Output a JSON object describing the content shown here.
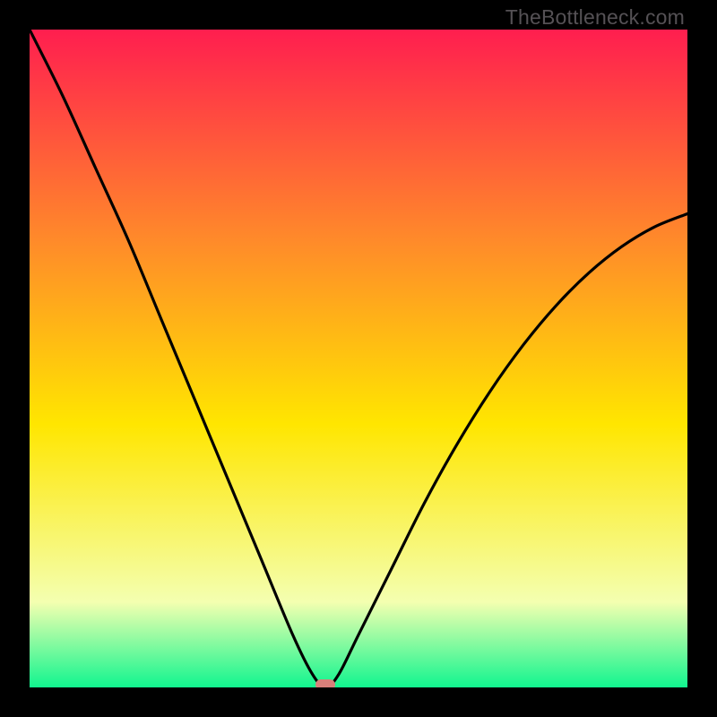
{
  "watermark": "TheBottleneck.com",
  "chart_data": {
    "type": "line",
    "title": "",
    "xlabel": "",
    "ylabel": "",
    "xlim": [
      0,
      100
    ],
    "ylim": [
      0,
      100
    ],
    "series": [
      {
        "name": "bottleneck-curve",
        "x": [
          0,
          5,
          10,
          15,
          20,
          25,
          30,
          35,
          40,
          43,
          45,
          47,
          50,
          55,
          60,
          65,
          70,
          75,
          80,
          85,
          90,
          95,
          100
        ],
        "y": [
          100,
          90,
          79,
          68,
          56,
          44,
          32,
          20,
          8,
          2,
          0,
          2,
          8,
          18,
          28,
          37,
          45,
          52,
          58,
          63,
          67,
          70,
          72
        ]
      }
    ],
    "minimum_point": {
      "x": 45,
      "y": 0
    },
    "gradient_colors": {
      "top": "#ff1e4f",
      "q1": "#ff8a2a",
      "mid": "#ffe600",
      "q3": "#f4ffb0",
      "bottom": "#11f58f"
    },
    "marker_color": "#d87f7a",
    "curve_color": "#000000"
  }
}
